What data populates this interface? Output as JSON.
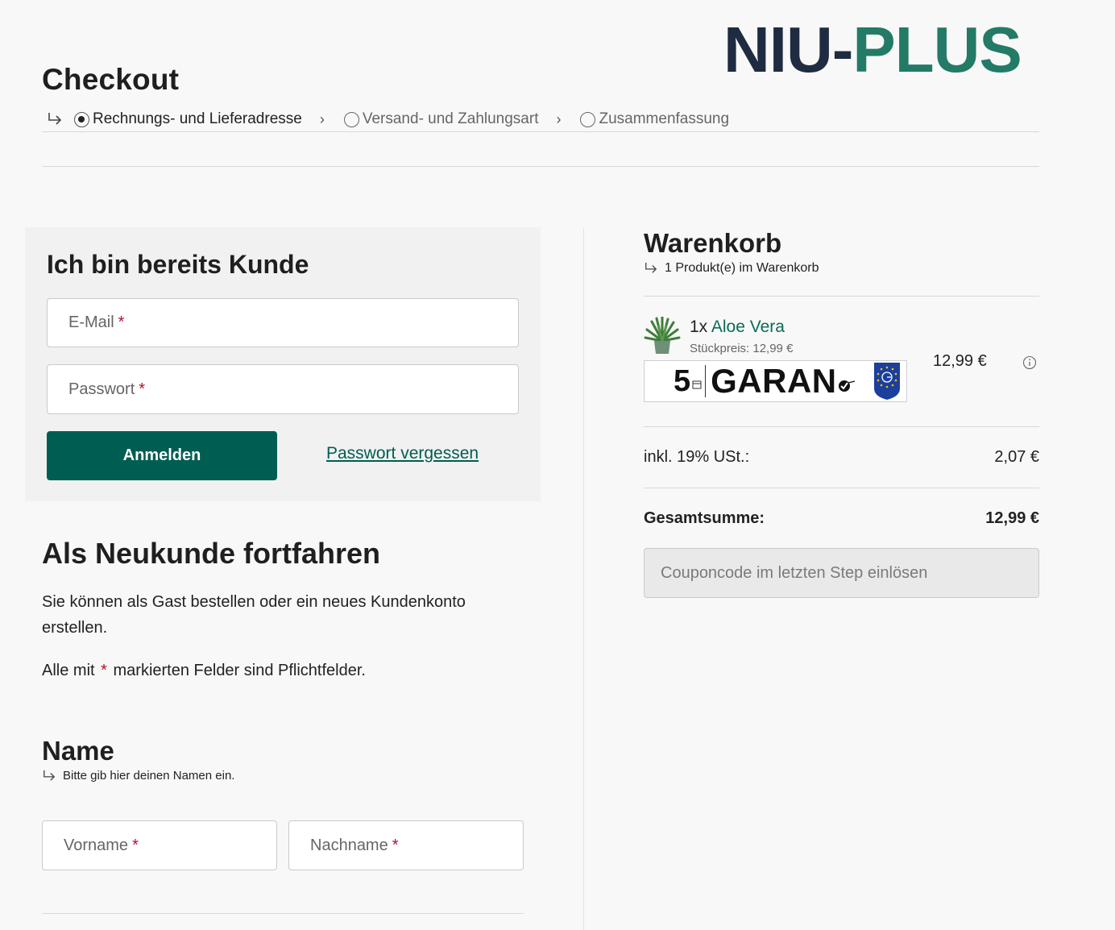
{
  "header": {
    "title": "Checkout",
    "logo": {
      "part1": "NIU-",
      "part2": "PLUS",
      "brand_color_dark": "#1e2b40",
      "brand_color_green": "#237a66"
    },
    "steps": [
      {
        "label": "Rechnungs- und Lieferadresse",
        "active": true
      },
      {
        "label": "Versand- und Zahlungsart",
        "active": false
      },
      {
        "label": "Zusammenfassung",
        "active": false
      }
    ]
  },
  "login": {
    "title": "Ich bin bereits Kunde",
    "email_placeholder": "E-Mail",
    "password_placeholder": "Passwort",
    "required_marker": "*",
    "submit_label": "Anmelden",
    "forgot_label": "Passwort vergessen"
  },
  "guest": {
    "title": "Als Neukunde fortfahren",
    "text_line1": "Sie können als Gast bestellen oder ein neues Kundenkonto",
    "text_line2": "erstellen.",
    "required_prefix": "Alle mit",
    "required_suffix": "markierten Felder sind Pflichtfelder.",
    "required_marker": "*"
  },
  "name_section": {
    "title": "Name",
    "hint": "Bitte gib hier deinen Namen ein.",
    "first_name_placeholder": "Vorname",
    "last_name_placeholder": "Nachname",
    "required_marker": "*"
  },
  "cart": {
    "title": "Warenkorb",
    "count_text": "1 Produkt(e) im Warenkorb",
    "item": {
      "quantity": "1x",
      "name": "Aloe Vera",
      "unit_price": "Stückpreis: 12,99 €",
      "price": "12,99 €",
      "guarantee_years": "5",
      "guarantee_word": "GARAN"
    },
    "tax_label": "inkl. 19% USt.:",
    "tax_value": "2,07 €",
    "total_label": "Gesamtsumme:",
    "total_value": "12,99 €",
    "coupon_placeholder": "Couponcode im letzten Step einlösen"
  },
  "colors": {
    "accent": "#005d52",
    "required": "#b0122d",
    "link": "#0a6b58"
  }
}
